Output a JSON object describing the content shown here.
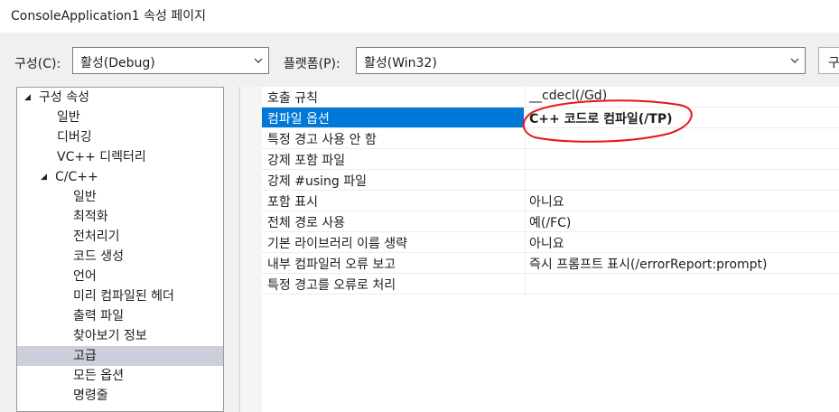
{
  "window": {
    "title": "ConsoleApplication1 속성 페이지"
  },
  "config": {
    "configuration_label": "구성(C):",
    "configuration_value": "활성(Debug)",
    "platform_label": "플랫폼(P):",
    "platform_value": "활성(Win32)",
    "right_button_label": "구"
  },
  "tree": {
    "items": [
      {
        "label": "구성 속성",
        "expanded": true
      },
      {
        "label": "일반"
      },
      {
        "label": "디버깅"
      },
      {
        "label": "VC++ 디렉터리"
      },
      {
        "label": "C/C++",
        "expanded": true
      },
      {
        "label": "일반"
      },
      {
        "label": "최적화"
      },
      {
        "label": "전처리기"
      },
      {
        "label": "코드 생성"
      },
      {
        "label": "언어"
      },
      {
        "label": "미리 컴파일된 헤더"
      },
      {
        "label": "출력 파일"
      },
      {
        "label": "찾아보기 정보"
      },
      {
        "label": "고급",
        "selected": true
      },
      {
        "label": "모든 옵션"
      },
      {
        "label": "명령줄"
      }
    ]
  },
  "properties": {
    "rows": [
      {
        "name": "호출 규칙",
        "value": "__cdecl(/Gd)"
      },
      {
        "name": "컴파일 옵션",
        "value": "C++ 코드로 컴파일(/TP)",
        "selected": true
      },
      {
        "name": "특정 경고 사용 안 함",
        "value": ""
      },
      {
        "name": "강제 포함 파일",
        "value": ""
      },
      {
        "name": "강제 #using 파일",
        "value": ""
      },
      {
        "name": "포함 표시",
        "value": "아니요"
      },
      {
        "name": "전체 경로 사용",
        "value": "예(/FC)"
      },
      {
        "name": "기본 라이브러리 이름 생략",
        "value": "아니요"
      },
      {
        "name": "내부 컴파일러 오류 보고",
        "value": "즉시 프롬프트 표시(/errorReport:prompt)"
      },
      {
        "name": "특정 경고를 오류로 처리",
        "value": ""
      }
    ]
  },
  "colors": {
    "selection_blue": "#0078d7",
    "tree_selection": "#cccedb",
    "annotation_red": "#e8141c"
  },
  "icons": {
    "expanded_arrow": "expand-triangle-icon",
    "dropdown": "chevron-down-icon"
  }
}
